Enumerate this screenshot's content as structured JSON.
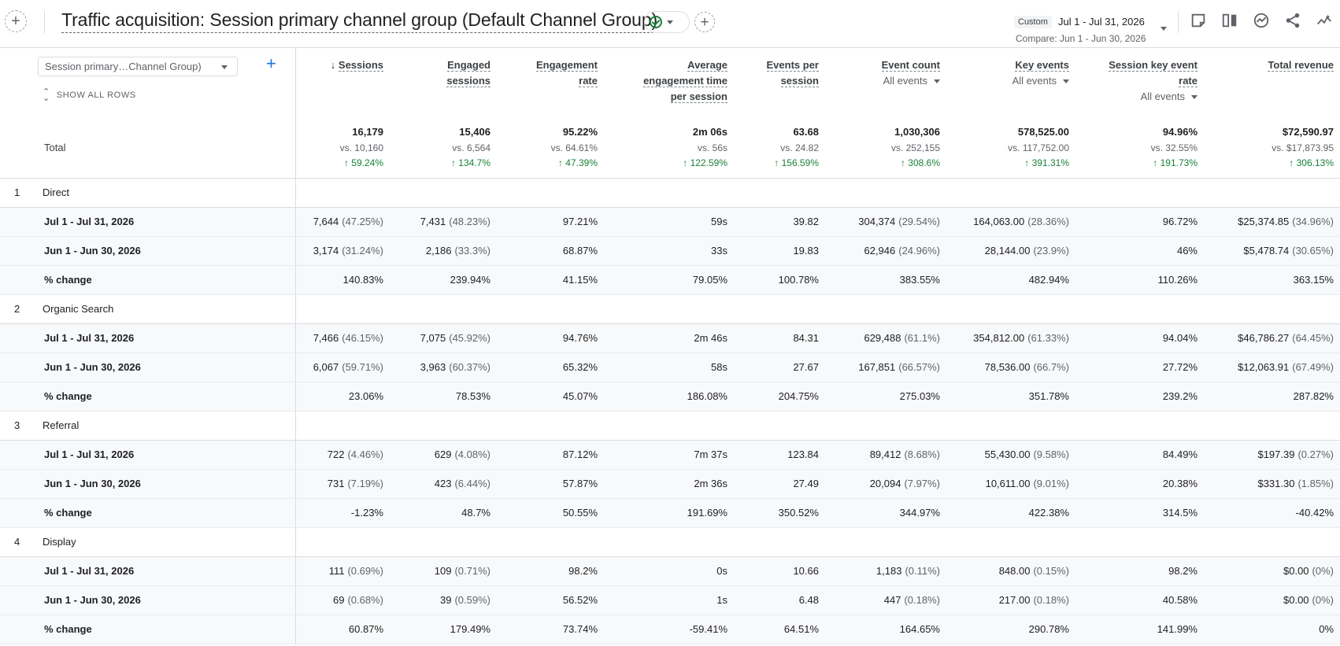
{
  "header": {
    "title": "Traffic acquisition: Session primary channel group (Default Channel Group)",
    "date_badge": "Custom",
    "date_range": "Jul 1 - Jul 31, 2026",
    "compare_range": "Compare: Jun 1 - Jun 30, 2026",
    "add_icon": "plus-icon",
    "icons": [
      "annotation-icon",
      "compare-columns-icon",
      "insights-icon",
      "share-icon",
      "trend-icon"
    ]
  },
  "table": {
    "dimension_select": "Session primary…Channel Group)",
    "show_all_rows": "SHOW ALL ROWS",
    "total_label": "Total",
    "columns": [
      {
        "lines": [
          "Sessions"
        ],
        "sorted": true
      },
      {
        "lines": [
          "Engaged",
          "sessions"
        ]
      },
      {
        "lines": [
          "Engagement",
          "rate"
        ]
      },
      {
        "lines": [
          "Average",
          "engagement time",
          "per session"
        ]
      },
      {
        "lines": [
          "Events per",
          "session"
        ]
      },
      {
        "lines": [
          "Event count"
        ],
        "selector": "All events"
      },
      {
        "lines": [
          "Key events"
        ],
        "selector": "All events"
      },
      {
        "lines": [
          "Session key event",
          "rate"
        ],
        "selector": "All events"
      },
      {
        "lines": [
          "Total revenue"
        ]
      }
    ],
    "totals": [
      {
        "value": "16,179",
        "vs": "vs. 10,160",
        "change": "59.24%"
      },
      {
        "value": "15,406",
        "vs": "vs. 6,564",
        "change": "134.7%"
      },
      {
        "value": "95.22%",
        "vs": "vs. 64.61%",
        "change": "47.39%"
      },
      {
        "value": "2m 06s",
        "vs": "vs. 56s",
        "change": "122.59%"
      },
      {
        "value": "63.68",
        "vs": "vs. 24.82",
        "change": "156.59%"
      },
      {
        "value": "1,030,306",
        "vs": "vs. 252,155",
        "change": "308.6%"
      },
      {
        "value": "578,525.00",
        "vs": "vs. 117,752.00",
        "change": "391.31%"
      },
      {
        "value": "94.96%",
        "vs": "vs. 32.55%",
        "change": "191.73%"
      },
      {
        "value": "$72,590.97",
        "vs": "vs. $17,873.95",
        "change": "306.13%"
      }
    ],
    "groups": [
      {
        "num": "1",
        "name": "Direct",
        "rows": [
          {
            "label": "Jul 1 - Jul 31, 2026",
            "cells": [
              [
                "7,644",
                "(47.25%)"
              ],
              [
                "7,431",
                "(48.23%)"
              ],
              [
                "97.21%"
              ],
              [
                "59s"
              ],
              [
                "39.82"
              ],
              [
                "304,374",
                "(29.54%)"
              ],
              [
                "164,063.00",
                "(28.36%)"
              ],
              [
                "96.72%"
              ],
              [
                "$25,374.85",
                "(34.96%)"
              ]
            ]
          },
          {
            "label": "Jun 1 - Jun 30, 2026",
            "cells": [
              [
                "3,174",
                "(31.24%)"
              ],
              [
                "2,186",
                "(33.3%)"
              ],
              [
                "68.87%"
              ],
              [
                "33s"
              ],
              [
                "19.83"
              ],
              [
                "62,946",
                "(24.96%)"
              ],
              [
                "28,144.00",
                "(23.9%)"
              ],
              [
                "46%"
              ],
              [
                "$5,478.74",
                "(30.65%)"
              ]
            ]
          },
          {
            "label": "% change",
            "cells": [
              [
                "140.83%"
              ],
              [
                "239.94%"
              ],
              [
                "41.15%"
              ],
              [
                "79.05%"
              ],
              [
                "100.78%"
              ],
              [
                "383.55%"
              ],
              [
                "482.94%"
              ],
              [
                "110.26%"
              ],
              [
                "363.15%"
              ]
            ]
          }
        ]
      },
      {
        "num": "2",
        "name": "Organic Search",
        "rows": [
          {
            "label": "Jul 1 - Jul 31, 2026",
            "cells": [
              [
                "7,466",
                "(46.15%)"
              ],
              [
                "7,075",
                "(45.92%)"
              ],
              [
                "94.76%"
              ],
              [
                "2m 46s"
              ],
              [
                "84.31"
              ],
              [
                "629,488",
                "(61.1%)"
              ],
              [
                "354,812.00",
                "(61.33%)"
              ],
              [
                "94.04%"
              ],
              [
                "$46,786.27",
                "(64.45%)"
              ]
            ]
          },
          {
            "label": "Jun 1 - Jun 30, 2026",
            "cells": [
              [
                "6,067",
                "(59.71%)"
              ],
              [
                "3,963",
                "(60.37%)"
              ],
              [
                "65.32%"
              ],
              [
                "58s"
              ],
              [
                "27.67"
              ],
              [
                "167,851",
                "(66.57%)"
              ],
              [
                "78,536.00",
                "(66.7%)"
              ],
              [
                "27.72%"
              ],
              [
                "$12,063.91",
                "(67.49%)"
              ]
            ]
          },
          {
            "label": "% change",
            "cells": [
              [
                "23.06%"
              ],
              [
                "78.53%"
              ],
              [
                "45.07%"
              ],
              [
                "186.08%"
              ],
              [
                "204.75%"
              ],
              [
                "275.03%"
              ],
              [
                "351.78%"
              ],
              [
                "239.2%"
              ],
              [
                "287.82%"
              ]
            ]
          }
        ]
      },
      {
        "num": "3",
        "name": "Referral",
        "rows": [
          {
            "label": "Jul 1 - Jul 31, 2026",
            "cells": [
              [
                "722",
                "(4.46%)"
              ],
              [
                "629",
                "(4.08%)"
              ],
              [
                "87.12%"
              ],
              [
                "7m 37s"
              ],
              [
                "123.84"
              ],
              [
                "89,412",
                "(8.68%)"
              ],
              [
                "55,430.00",
                "(9.58%)"
              ],
              [
                "84.49%"
              ],
              [
                "$197.39",
                "(0.27%)"
              ]
            ]
          },
          {
            "label": "Jun 1 - Jun 30, 2026",
            "cells": [
              [
                "731",
                "(7.19%)"
              ],
              [
                "423",
                "(6.44%)"
              ],
              [
                "57.87%"
              ],
              [
                "2m 36s"
              ],
              [
                "27.49"
              ],
              [
                "20,094",
                "(7.97%)"
              ],
              [
                "10,611.00",
                "(9.01%)"
              ],
              [
                "20.38%"
              ],
              [
                "$331.30",
                "(1.85%)"
              ]
            ]
          },
          {
            "label": "% change",
            "cells": [
              [
                "-1.23%"
              ],
              [
                "48.7%"
              ],
              [
                "50.55%"
              ],
              [
                "191.69%"
              ],
              [
                "350.52%"
              ],
              [
                "344.97%"
              ],
              [
                "422.38%"
              ],
              [
                "314.5%"
              ],
              [
                "-40.42%"
              ]
            ]
          }
        ]
      },
      {
        "num": "4",
        "name": "Display",
        "rows": [
          {
            "label": "Jul 1 - Jul 31, 2026",
            "cells": [
              [
                "111",
                "(0.69%)"
              ],
              [
                "109",
                "(0.71%)"
              ],
              [
                "98.2%"
              ],
              [
                "0s"
              ],
              [
                "10.66"
              ],
              [
                "1,183",
                "(0.11%)"
              ],
              [
                "848.00",
                "(0.15%)"
              ],
              [
                "98.2%"
              ],
              [
                "$0.00",
                "(0%)"
              ]
            ]
          },
          {
            "label": "Jun 1 - Jun 30, 2026",
            "cells": [
              [
                "69",
                "(0.68%)"
              ],
              [
                "39",
                "(0.59%)"
              ],
              [
                "56.52%"
              ],
              [
                "1s"
              ],
              [
                "6.48"
              ],
              [
                "447",
                "(0.18%)"
              ],
              [
                "217.00",
                "(0.18%)"
              ],
              [
                "40.58%"
              ],
              [
                "$0.00",
                "(0%)"
              ]
            ]
          },
          {
            "label": "% change",
            "cells": [
              [
                "60.87%"
              ],
              [
                "179.49%"
              ],
              [
                "73.74%"
              ],
              [
                "-59.41%"
              ],
              [
                "64.51%"
              ],
              [
                "164.65%"
              ],
              [
                "290.78%"
              ],
              [
                "141.99%"
              ],
              [
                "0%"
              ]
            ]
          }
        ]
      }
    ]
  }
}
